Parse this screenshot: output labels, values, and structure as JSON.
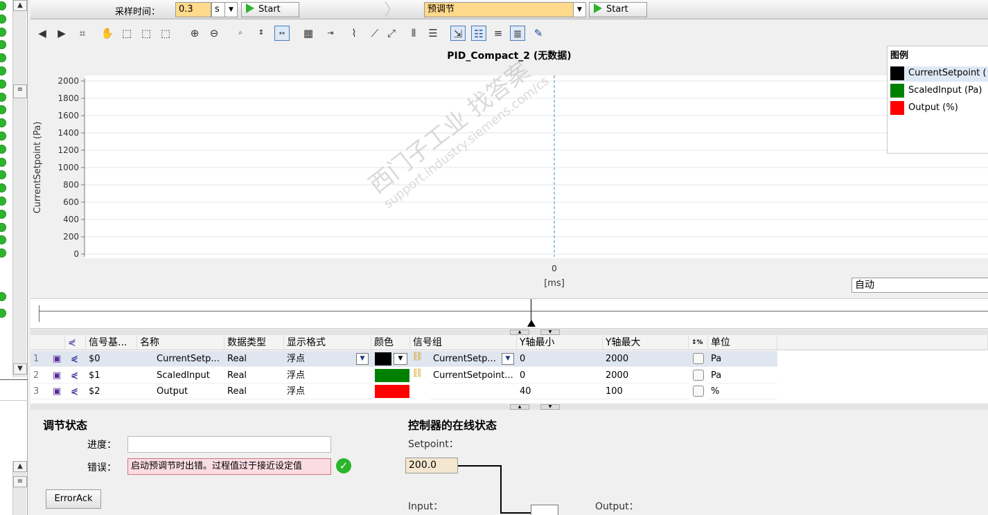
{
  "top": {
    "sample_label": "采样时间：",
    "sample_value": "0.3",
    "sample_unit": "s",
    "start1_label": "Start",
    "mode_value": "预调节",
    "start2_label": "Start"
  },
  "chart": {
    "title": "PID_Compact_2 (无数据)",
    "ylabel": "CurrentSetpoint (Pa)",
    "xlabel": "[ms]",
    "x_tick": "0",
    "yticks": [
      "2000",
      "1800",
      "1600",
      "1400",
      "1200",
      "1000",
      "800",
      "600",
      "400",
      "200",
      "0"
    ],
    "mode_select": "自动",
    "watermark1": "西门子工业 找答案",
    "watermark2": "support.industry.siemens.com/cs"
  },
  "chart_data": {
    "type": "line",
    "title": "PID_Compact_2 (无数据)",
    "xlabel": "[ms]",
    "ylabel": "CurrentSetpoint (Pa)",
    "ylim": [
      0,
      2000
    ],
    "x": [],
    "series": [
      {
        "name": "CurrentSetpoint (",
        "values": [],
        "color": "#000000"
      },
      {
        "name": "ScaledInput (Pa)",
        "values": [],
        "color": "#008000"
      },
      {
        "name": "Output (%)",
        "values": [],
        "color": "#ff0000"
      }
    ],
    "grid": true,
    "legend": "top-right"
  },
  "legend": {
    "title": "图例",
    "items": [
      {
        "label": "CurrentSetpoint (",
        "color": "#000000"
      },
      {
        "label": "ScaledInput (Pa)",
        "color": "#008000"
      },
      {
        "label": "Output (%)",
        "color": "#ff0000"
      }
    ]
  },
  "grid": {
    "headers": {
      "sig": "信号基...",
      "name": "名称",
      "dtype": "数据类型",
      "fmt": "显示格式",
      "color": "颜色",
      "group": "信号组",
      "ymin": "Y轴最小",
      "ymax": "Y轴最大",
      "unit": "单位"
    },
    "rows": [
      {
        "num": "1",
        "sig": "$0",
        "name": "CurrentSetp...",
        "dtype": "Real",
        "fmt": "浮点",
        "color": "#000000",
        "group": "CurrentSetp...",
        "ymin": "0",
        "ymax": "2000",
        "unit": "Pa"
      },
      {
        "num": "2",
        "sig": "$1",
        "name": "ScaledInput",
        "dtype": "Real",
        "fmt": "浮点",
        "color": "#008000",
        "group": "CurrentSetpoint...",
        "ymin": "0",
        "ymax": "2000",
        "unit": "Pa"
      },
      {
        "num": "3",
        "sig": "$2",
        "name": "Output",
        "dtype": "Real",
        "fmt": "浮点",
        "color": "#ff0000",
        "group": "",
        "ymin": "40",
        "ymax": "100",
        "unit": "%"
      }
    ]
  },
  "status": {
    "title": "调节状态",
    "progress_label": "进度：",
    "progress_value": "",
    "error_label": "错误：",
    "error_value": "启动预调节时出错。过程值过于接近设定值",
    "errorack_label": "ErrorAck"
  },
  "online": {
    "title": "控制器的在线状态",
    "setpoint_label": "Setpoint：",
    "setpoint_value": "200.0",
    "input_label": "Input：",
    "output_label": "Output："
  }
}
